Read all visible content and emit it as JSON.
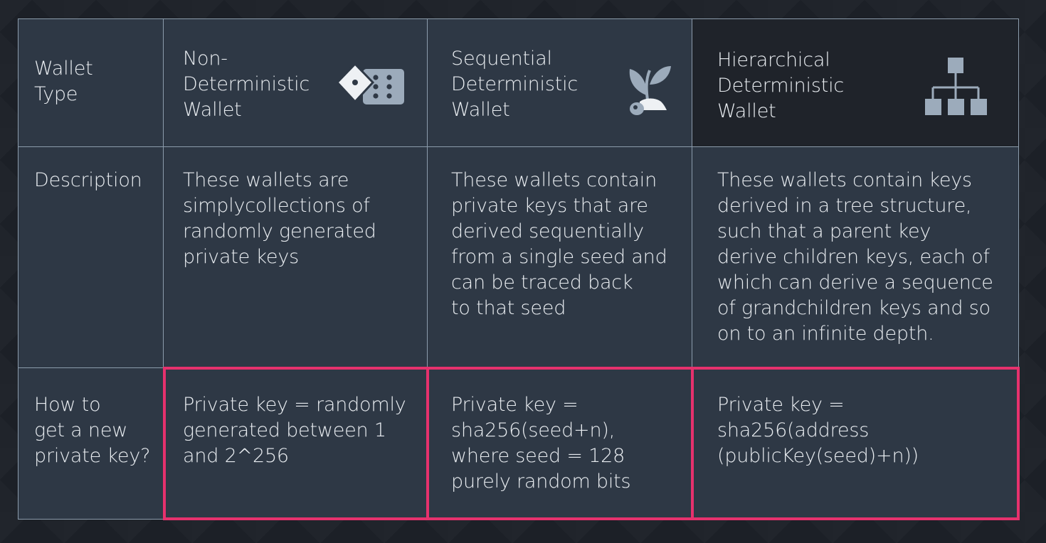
{
  "header": {
    "label": "Wallet\nType",
    "columns": [
      {
        "title": "Non-\nDeterministic\nWallet",
        "icon": "dice-icon"
      },
      {
        "title": "Sequential\nDeterministic\nWallet",
        "icon": "sprout-icon"
      },
      {
        "title": "Hierarchical\nDeterministic\nWallet",
        "icon": "hierarchy-icon"
      }
    ]
  },
  "description": {
    "label": "Description",
    "values": [
      "These wallets are\nsimplycollections of\nrandomly generated\nprivate keys",
      "These wallets contain\nprivate keys that are\nderived sequentially\nfrom a single seed and\ncan be traced back\nto that seed",
      "These wallets contain keys\nderived in a tree structure,\nsuch that a parent key\nderive children keys, each of\nwhich can derive a sequence\nof grandchildren keys and so\non to an infinite depth."
    ]
  },
  "new_key": {
    "label": "How to\nget a new\nprivate key?",
    "values": [
      "Private key = randomly\ngenerated between 1\nand 2^256",
      "Private key =\nsha256(seed+n),\nwhere seed = 128\npurely random bits",
      "Private key =\nsha256(address\n(publicKey(seed)+n))"
    ]
  },
  "colors": {
    "cell_bg": "#2e3845",
    "highlight": "#e6316d",
    "icon": "#9cabbb"
  }
}
